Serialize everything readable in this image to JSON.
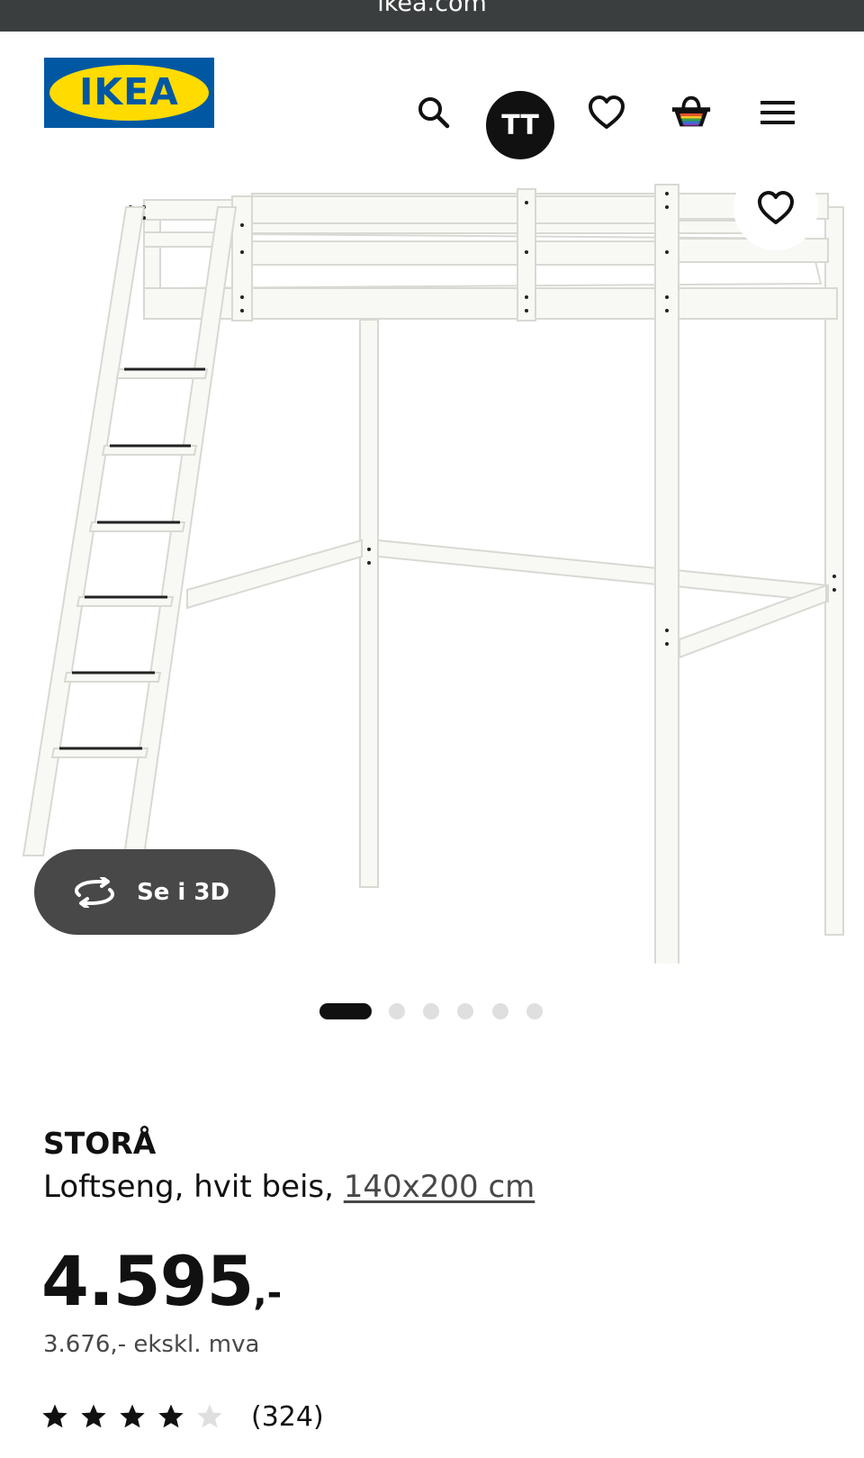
{
  "browser": {
    "url": "ikea.com"
  },
  "header": {
    "logo_text": "IKEA",
    "avatar_initials": "TT",
    "icons": [
      "search-icon",
      "heart-icon",
      "basket-icon",
      "menu-icon"
    ]
  },
  "gallery": {
    "button_3d_label": "Se i 3D",
    "image_count": 6,
    "active_index": 0
  },
  "product": {
    "name": "STORÅ",
    "description": "Loftseng, hvit beis, ",
    "size_link": "140x200 cm",
    "price": "4.595",
    "price_suffix": ",-",
    "price_ex_vat": "3.676,- ekskl. mva",
    "rating_value": 4,
    "rating_max": 5,
    "review_count": "(324)"
  },
  "colors": {
    "ikea_blue": "#0058a3",
    "ikea_yellow": "#ffdb00",
    "text": "#111111",
    "muted": "#484848",
    "star_empty": "#dfdfdf"
  }
}
